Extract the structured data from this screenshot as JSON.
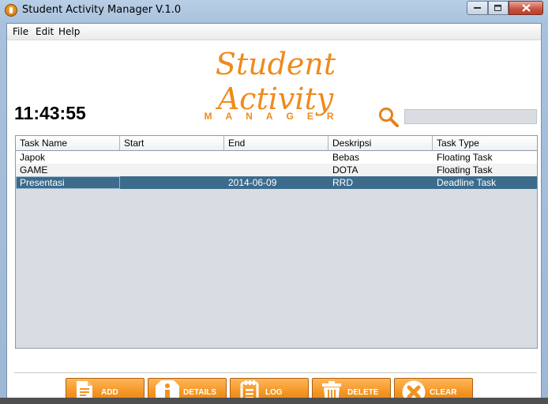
{
  "window": {
    "title": "Student Activity Manager V.1.0"
  },
  "menu": [
    "File",
    "Edit",
    "Help"
  ],
  "logo": {
    "main": "Student Activity",
    "sub": "MANAGER"
  },
  "clock": "11:43:55",
  "search": {
    "value": ""
  },
  "table": {
    "columns": [
      "Task Name",
      "Start",
      "End",
      "Deskripsi",
      "Task Type"
    ],
    "rows": [
      [
        "Japok",
        "",
        "",
        "Bebas",
        "Floating Task"
      ],
      [
        "GAME",
        "",
        "",
        "DOTA",
        "Floating Task"
      ],
      [
        "Presentasi",
        "",
        "2014-06-09",
        "RRD",
        "Deadline Task"
      ]
    ],
    "selected_row": 2
  },
  "buttons": [
    {
      "label": "ADD",
      "icon": "add-document-icon"
    },
    {
      "label": "DETAILS",
      "icon": "info-icon"
    },
    {
      "label": "LOG",
      "icon": "log-notepad-icon"
    },
    {
      "label": "DELETE",
      "icon": "trash-icon"
    },
    {
      "label": "CLEAR",
      "icon": "clear-x-icon"
    }
  ],
  "colors": {
    "accent": "#f08a1c",
    "selection": "#3c6b8c"
  }
}
